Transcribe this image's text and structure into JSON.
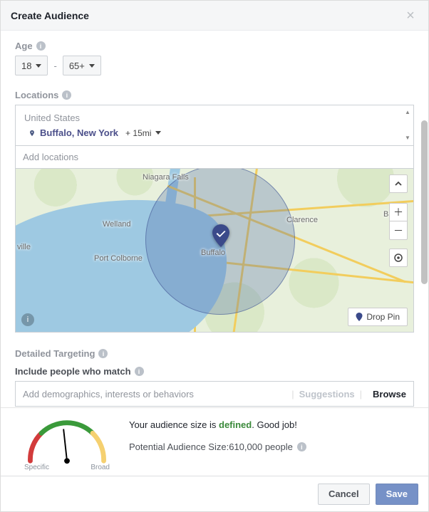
{
  "header": {
    "title": "Create Audience"
  },
  "age": {
    "label": "Age",
    "min": "18",
    "max": "65+"
  },
  "locations": {
    "label": "Locations",
    "country": "United States",
    "place": "Buffalo, New York",
    "distance": "+ 15mi",
    "add_placeholder": "Add locations",
    "drop_pin_label": "Drop Pin",
    "map_places": {
      "buffalo": "Buffalo",
      "niagara": "Niagara Falls",
      "welland": "Welland",
      "port": "Port Colborne",
      "ville": "ville",
      "clarence": "Clarence",
      "bat": "Bat"
    }
  },
  "detailed": {
    "label": "Detailed Targeting",
    "include_label": "Include people who match",
    "input_placeholder": "Add demographics, interests or behaviors",
    "suggestions": "Suggestions",
    "browse": "Browse"
  },
  "summary": {
    "prefix": "Your audience size is ",
    "status_word": "defined",
    "suffix": ". Good job!",
    "potential_label": "Potential Audience Size: ",
    "potential_value": "610,000 people",
    "gauge_left": "Specific",
    "gauge_right": "Broad"
  },
  "footer": {
    "cancel": "Cancel",
    "save": "Save"
  }
}
